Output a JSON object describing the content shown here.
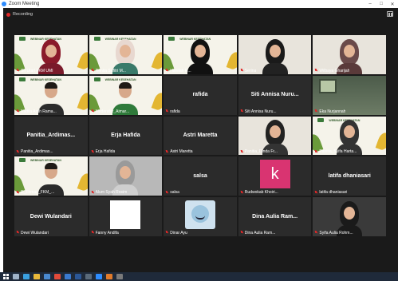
{
  "window": {
    "title": "Zoom Meeting",
    "controls": [
      "–",
      "□",
      "✕"
    ]
  },
  "meeting": {
    "recording_label": "Recording"
  },
  "banner_title": "WEBINAR KESEHATAN",
  "participants": [
    {
      "name": "Sri Utari FKM UMI",
      "type": "video",
      "bg": "banner",
      "hijab": "#8a1a2a",
      "clothes": "#7a1a2a"
    },
    {
      "name": "Renita Safitri M...",
      "type": "video",
      "bg": "banner",
      "hijab": "#e8d8d0",
      "clothes": "#3a7a6a"
    },
    {
      "name": "Hanifah R...",
      "type": "video",
      "bg": "banner",
      "hijab": "#111111",
      "clothes": "#111111"
    },
    {
      "name": "Serina",
      "type": "video",
      "bg": "light",
      "hijab": "#1a1a1a",
      "clothes": "#222222"
    },
    {
      "name": "Wilbaya Gharijah",
      "type": "video",
      "bg": "light",
      "hijab": "#6a4a4a",
      "clothes": "#5a3a3a"
    },
    {
      "name": "Nadila Ardh Rama...",
      "type": "video",
      "bg": "banner",
      "hair": true,
      "clothes": "#2c2c2c"
    },
    {
      "name": "Moderator_Aimar...",
      "type": "video",
      "bg": "banner",
      "hair": true,
      "clothes": "#2f7a3a"
    },
    {
      "name": "rafida",
      "type": "name"
    },
    {
      "name": "Siti Annisa Nuru...",
      "type": "name"
    },
    {
      "name": "Eka Nurjannah",
      "type": "room"
    },
    {
      "name": "Panitia_Ardimas...",
      "type": "name"
    },
    {
      "name": "Erja Hafida",
      "type": "name"
    },
    {
      "name": "Astri Maretta",
      "type": "name"
    },
    {
      "name": "Panitia_Dinda Fr...",
      "type": "video",
      "bg": "light",
      "hijab": "#222222",
      "clothes": "#333333"
    },
    {
      "name": "Panitia_Syifa Harta...",
      "type": "video",
      "bg": "banner",
      "hijab": "#333333",
      "clothes": "#333333"
    },
    {
      "name": "R_Firman_FKM_...",
      "type": "video",
      "bg": "banner",
      "hair": true,
      "clothes": "#2a2a2a"
    },
    {
      "name": "Alum Syah Rosim",
      "type": "video",
      "bg": "grey",
      "hijab": "#9a9a9a",
      "clothes": "#cfcfcf"
    },
    {
      "name": "salsa",
      "type": "name"
    },
    {
      "name": "Rudwokab Khoiri...",
      "type": "k",
      "letter": "k"
    },
    {
      "name": "latifa dhaniasari",
      "type": "name"
    },
    {
      "name": "Dewi Wulandari",
      "type": "name"
    },
    {
      "name": "Fanny Andifa",
      "type": "white"
    },
    {
      "name": "Dinar Ayu",
      "type": "emoji"
    },
    {
      "name": "Dina Aulia Ram...",
      "type": "name"
    },
    {
      "name": "Syifa Aulia Rohm...",
      "type": "video",
      "bg": "dark",
      "hijab": "#1a1a1a",
      "clothes": "#1a1a1a"
    }
  ],
  "taskbar": {
    "icons": [
      {
        "name": "start-icon",
        "color": "#ffffff"
      },
      {
        "name": "search-icon",
        "color": "#9fb3c8"
      },
      {
        "name": "edge-icon",
        "color": "#3aa0e0"
      },
      {
        "name": "folder-icon",
        "color": "#e8b83a"
      },
      {
        "name": "store-icon",
        "color": "#4a8ad0"
      },
      {
        "name": "chrome-icon",
        "color": "#e04a3a"
      },
      {
        "name": "mail-icon",
        "color": "#3a7ad0"
      },
      {
        "name": "word-icon",
        "color": "#2b5797"
      },
      {
        "name": "app-icon",
        "color": "#5a6a7a"
      },
      {
        "name": "zoom-icon",
        "color": "#2d8cff"
      },
      {
        "name": "paint-icon",
        "color": "#e07a2a"
      },
      {
        "name": "note-icon",
        "color": "#7a7a7a"
      }
    ]
  }
}
